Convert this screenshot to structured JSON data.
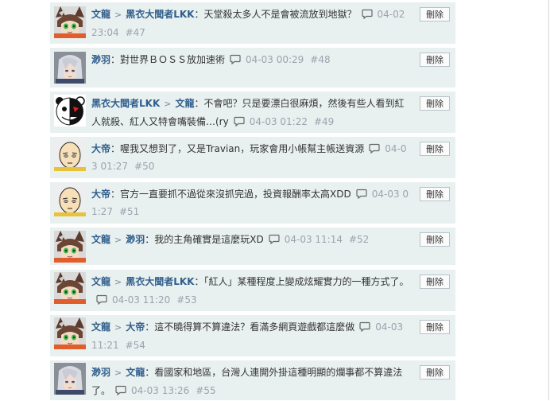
{
  "delete_label": "刪除",
  "comments": [
    {
      "avatar": "anime-cat-girl",
      "author": "文龍",
      "reply_to": "黑衣大聞者LKK",
      "text": "：天堂殺太多人不是會被流放到地獄？",
      "time": "04-02 23:04",
      "num": "#47"
    },
    {
      "avatar": "silver-hair-character",
      "author": "渺羽",
      "reply_to": "",
      "text": "：對世界ＢＯＳＳ放加速術",
      "time": "04-03 00:29",
      "num": "#48"
    },
    {
      "avatar": "monokuma",
      "author": "黑衣大聞者LKK",
      "reply_to": "文龍",
      "text": "：不會吧？只是要漂白很麻煩，然後有些人看到紅人就殺、紅人又特會嘴裝備…(ry",
      "time": "04-03 01:22",
      "num": "#49"
    },
    {
      "avatar": "bald-hero",
      "author": "大帝",
      "reply_to": "",
      "text": "：喔我又想到了，又是Travian，玩家會用小帳幫主帳送資源",
      "time": "04-03 01:27",
      "num": "#50"
    },
    {
      "avatar": "bald-hero",
      "author": "大帝",
      "reply_to": "",
      "text": "：官方一直要抓不過從來沒抓完過，投資報酬率太高XDD",
      "time": "04-03 01:27",
      "num": "#51"
    },
    {
      "avatar": "anime-cat-girl",
      "author": "文龍",
      "reply_to": "渺羽",
      "text": "：我的主角確實是這麼玩XD",
      "time": "04-03 11:14",
      "num": "#52"
    },
    {
      "avatar": "anime-cat-girl",
      "author": "文龍",
      "reply_to": "黑衣大聞者LKK",
      "text": "：「紅人」某種程度上變成炫耀實力的一種方式了。",
      "time": "04-03 11:20",
      "num": "#53"
    },
    {
      "avatar": "anime-cat-girl",
      "author": "文龍",
      "reply_to": "大帝",
      "text": "：這不曉得算不算違法？看滿多網頁遊戲都這麼做",
      "time": "04-03 11:21",
      "num": "#54"
    },
    {
      "avatar": "silver-hair-character",
      "author": "渺羽",
      "reply_to": "文龍",
      "text": "：看國家和地區，台灣人連開外掛這種明顯的爛事都不算違法了。",
      "time": "04-03 13:26",
      "num": "#55"
    }
  ]
}
